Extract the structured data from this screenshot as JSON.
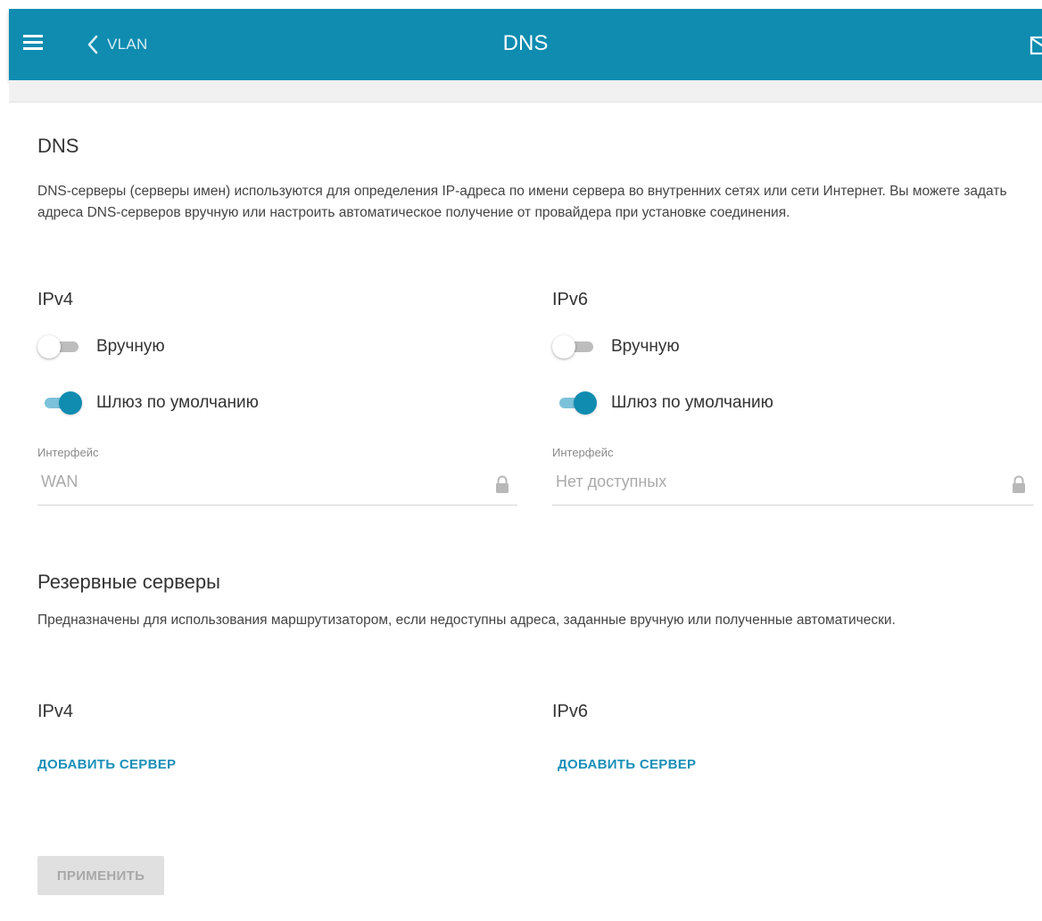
{
  "header": {
    "back_label": "VLAN",
    "title": "DNS",
    "menu_icon": "hamburger-menu-icon",
    "back_icon": "chevron-left-icon",
    "mail_icon": "mail-icon"
  },
  "colors": {
    "accent": "#0f8cb0",
    "link": "#1a8fb8",
    "toggle_track_on": "#7cc1da",
    "toggle_track_off": "#bdbdbd"
  },
  "dns_section": {
    "title": "DNS",
    "description": "DNS-серверы (серверы имен) используются для определения IP-адреса по имени сервера во внутренних сетях или сети Интернет. Вы можете задать адреса DNS-серверов вручную или настроить автоматическое получение от провайдера при установке соединения.",
    "ipv4": {
      "title": "IPv4",
      "manual": {
        "label": "Вручную",
        "enabled": false
      },
      "default_gateway": {
        "label": "Шлюз по умолчанию",
        "enabled": true
      },
      "interface": {
        "label": "Интерфейс",
        "value": "WAN",
        "locked": true
      }
    },
    "ipv6": {
      "title": "IPv6",
      "manual": {
        "label": "Вручную",
        "enabled": false
      },
      "default_gateway": {
        "label": "Шлюз по умолчанию",
        "enabled": true
      },
      "interface": {
        "label": "Интерфейс",
        "value": "Нет доступных",
        "locked": true
      }
    }
  },
  "backup_section": {
    "title": "Резервные серверы",
    "description": "Предназначены для использования маршрутизатором, если недоступны адреса, заданные вручную или полученные автоматически.",
    "ipv4": {
      "title": "IPv4",
      "add_label": "ДОБАВИТЬ СЕРВЕР"
    },
    "ipv6": {
      "title": "IPv6",
      "add_label": "ДОБАВИТЬ СЕРВЕР"
    }
  },
  "actions": {
    "apply_label": "ПРИМЕНИТЬ",
    "apply_enabled": false
  }
}
